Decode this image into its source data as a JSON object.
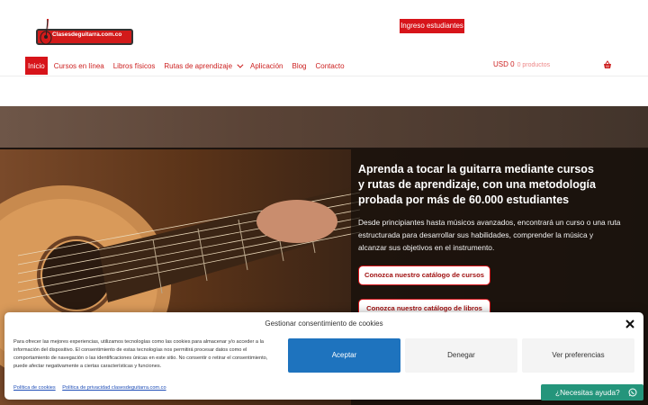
{
  "header": {
    "logo_text": "Clasesdeguitarra.com.co",
    "login_button": "Ingreso estudiantes"
  },
  "nav": {
    "items": [
      {
        "label": "Inicio",
        "active": true
      },
      {
        "label": "Cursos en línea"
      },
      {
        "label": "Libros físicos"
      },
      {
        "label": "Rutas de aprendizaje",
        "has_dropdown": true
      },
      {
        "label": "Aplicación"
      },
      {
        "label": "Blog"
      },
      {
        "label": "Contacto"
      }
    ],
    "cart_amount": "USD 0",
    "cart_count": "0 productos"
  },
  "hero": {
    "title": "Aprenda a tocar la guitarra mediante cursos y rutas de aprendizaje, con una metodología probada por más de 60.000 estudiantes",
    "subtitle": "Desde principiantes hasta músicos avanzados, encontrará un curso o una ruta estructurada para desarrollar sus habilidades, comprender la música y alcanzar sus objetivos en el instrumento.",
    "btn_courses": "Conozca nuestro catálogo de cursos",
    "btn_books": "Conozca nuestro catálogo de libros"
  },
  "cookie": {
    "title": "Gestionar consentimiento de cookies",
    "text": "Para ofrecer las mejores experiencias, utilizamos tecnologías como las cookies para almacenar y/o acceder a la información del dispositivo. El consentimiento de estas tecnologías nos permitirá procesar datos como el comportamiento de navegación o las identificaciones únicas en este sitio. No consentir o retirar el consentimiento, puede afectar negativamente a ciertas características y funciones.",
    "accept": "Aceptar",
    "deny": "Denegar",
    "preferences": "Ver preferencias",
    "link_cookie_policy": "Política de cookies",
    "link_privacy": "Política de privacidad clasesdeguitarra.com.co"
  },
  "whatsapp": {
    "label": "¿Necesitas ayuda?"
  },
  "colors": {
    "brand_red": "#d7141a",
    "accept_blue": "#1e73be",
    "whatsapp_green": "#24957b"
  }
}
